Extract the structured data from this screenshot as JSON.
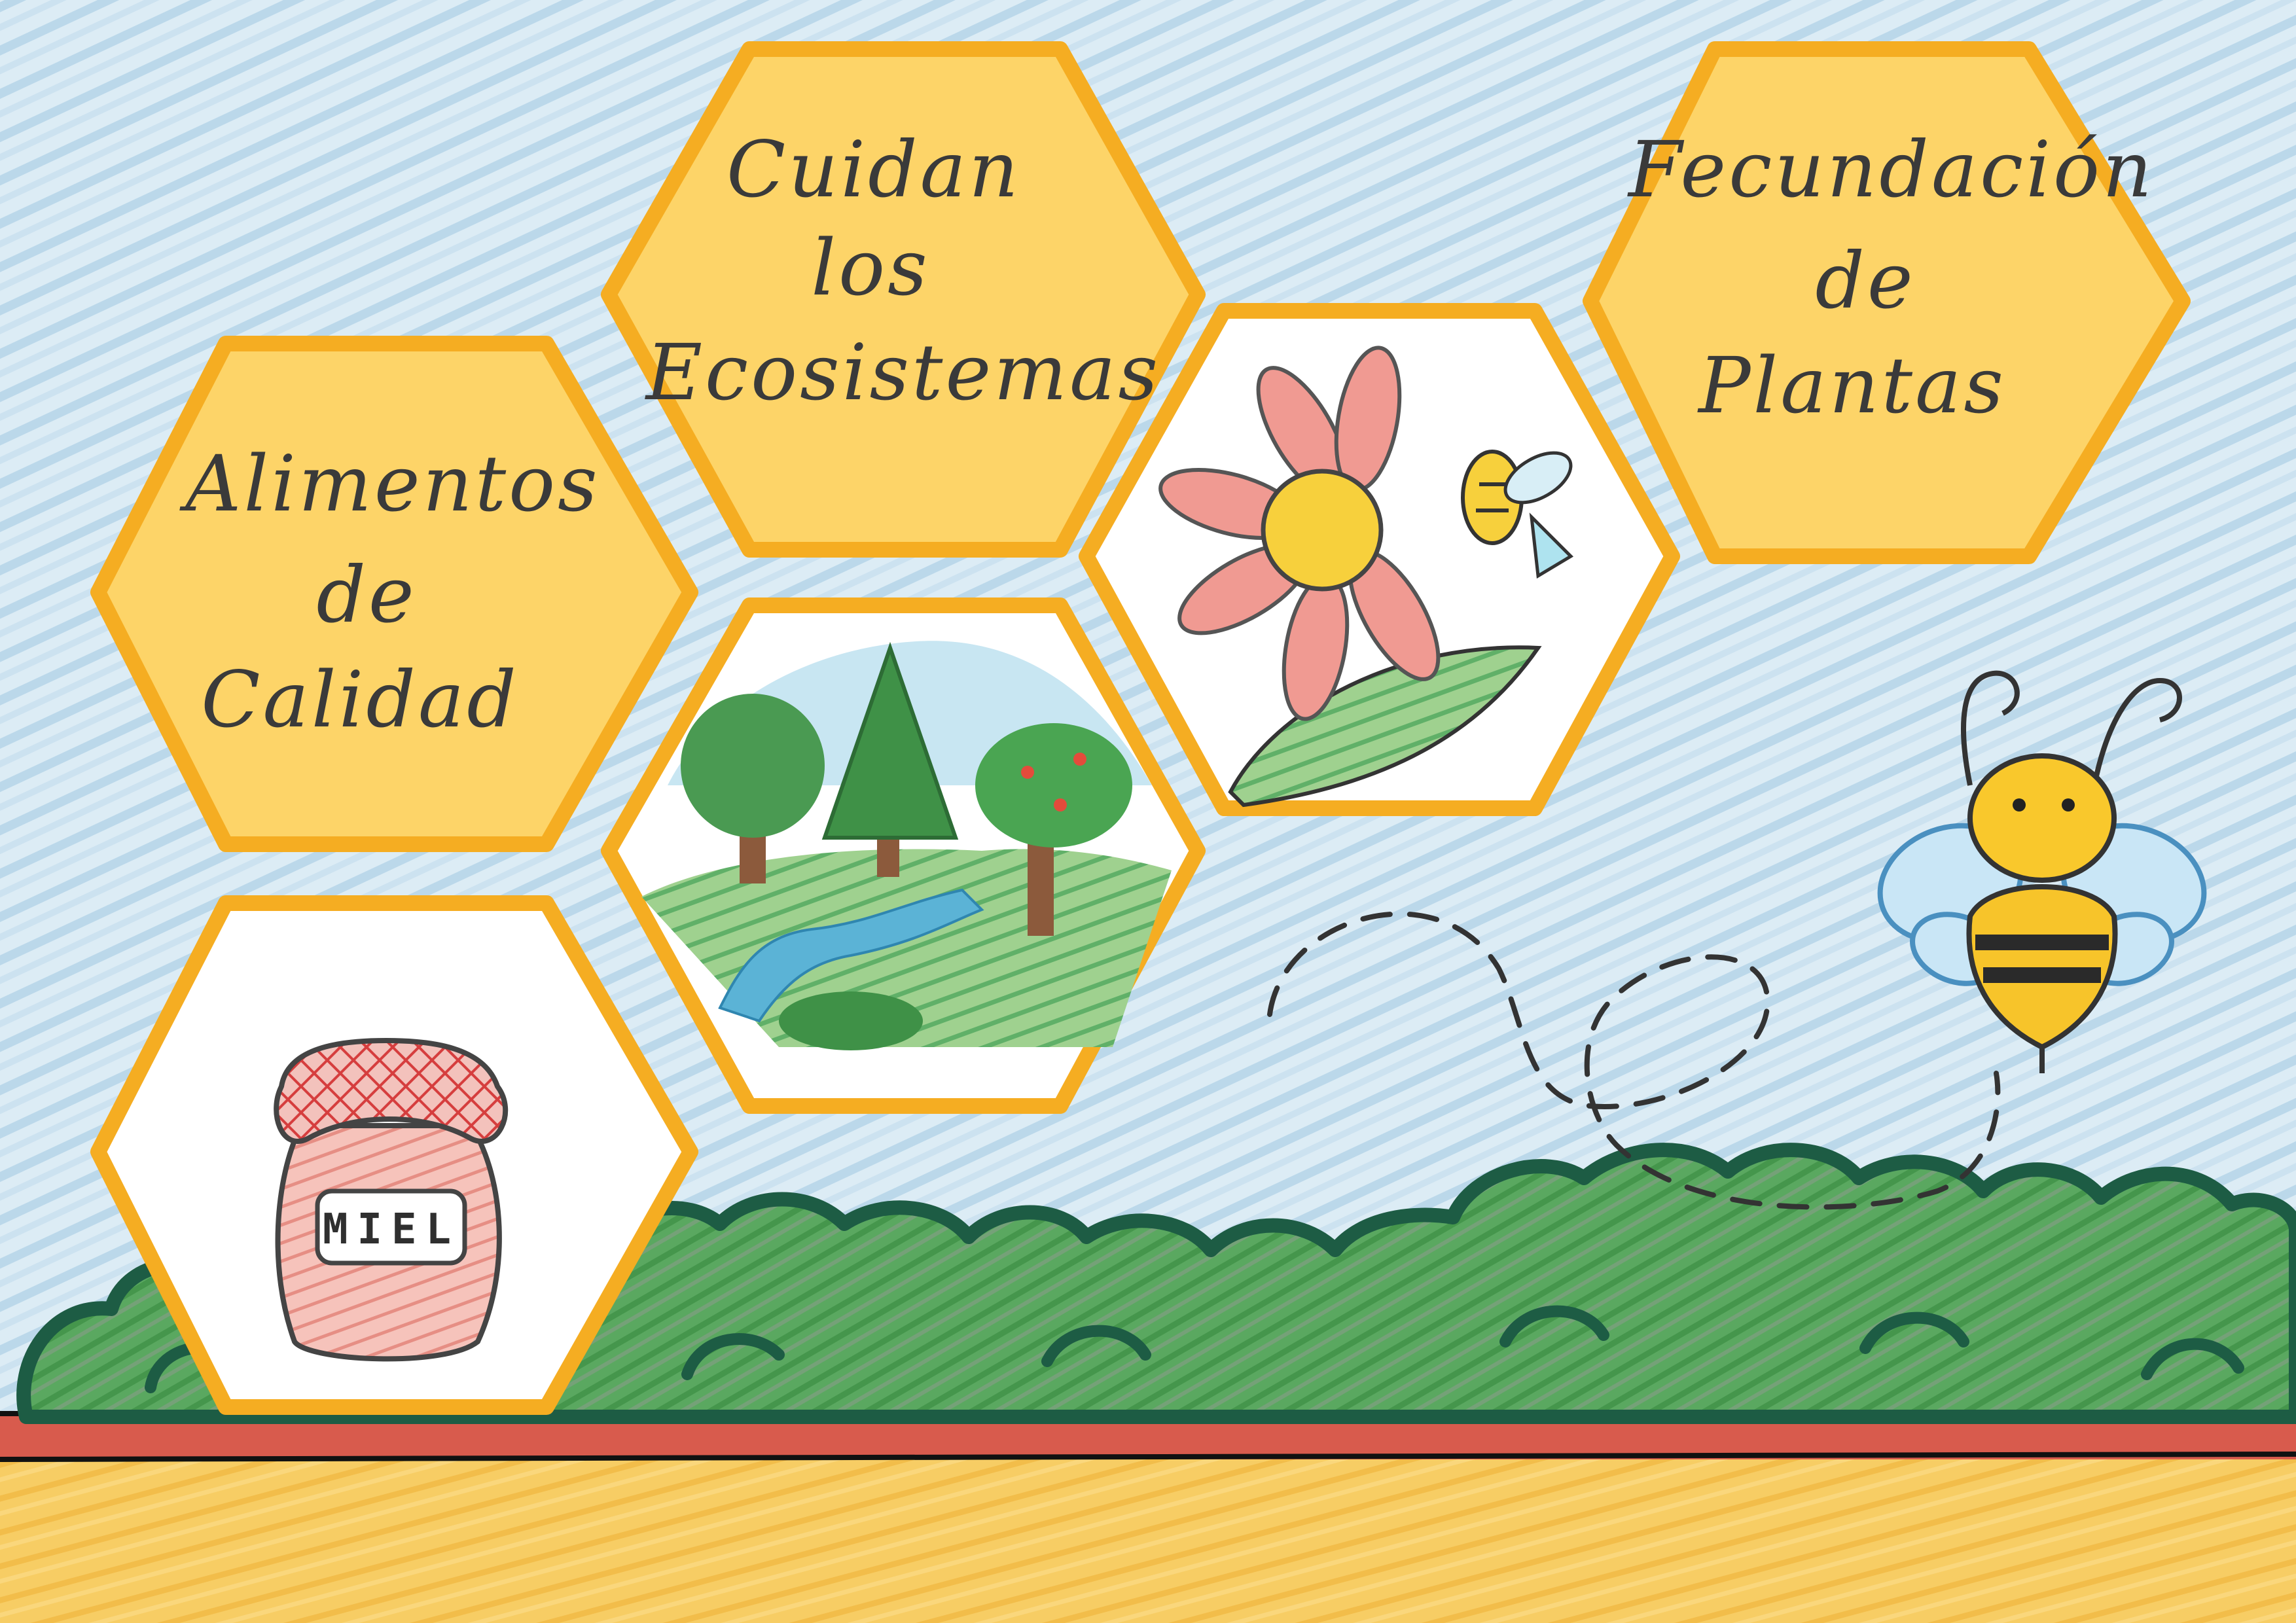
{
  "hexagons": {
    "alimentos": {
      "lines": [
        "Alimentos",
        "de",
        "Calidad"
      ]
    },
    "cuidan": {
      "lines": [
        "Cuidan",
        "los",
        "Ecosistemas"
      ]
    },
    "fecundacion": {
      "lines": [
        "Fecundación",
        "de",
        "Plantas"
      ]
    }
  },
  "jar": {
    "label": "MIEL"
  },
  "colors": {
    "sky": "#cfe3ef",
    "sky_stroke": "#a9cde3",
    "hex_fill": "#fdd468",
    "hex_border": "#f5ad22",
    "bush": "#3c9a46",
    "bush_outline": "#1d5c44",
    "soil": "#d85b4d",
    "ground": "#f6c95c"
  },
  "icons": [
    "honey-jar-icon",
    "forest-icon",
    "flower-bee-icon",
    "bee-icon",
    "bush-icon"
  ]
}
